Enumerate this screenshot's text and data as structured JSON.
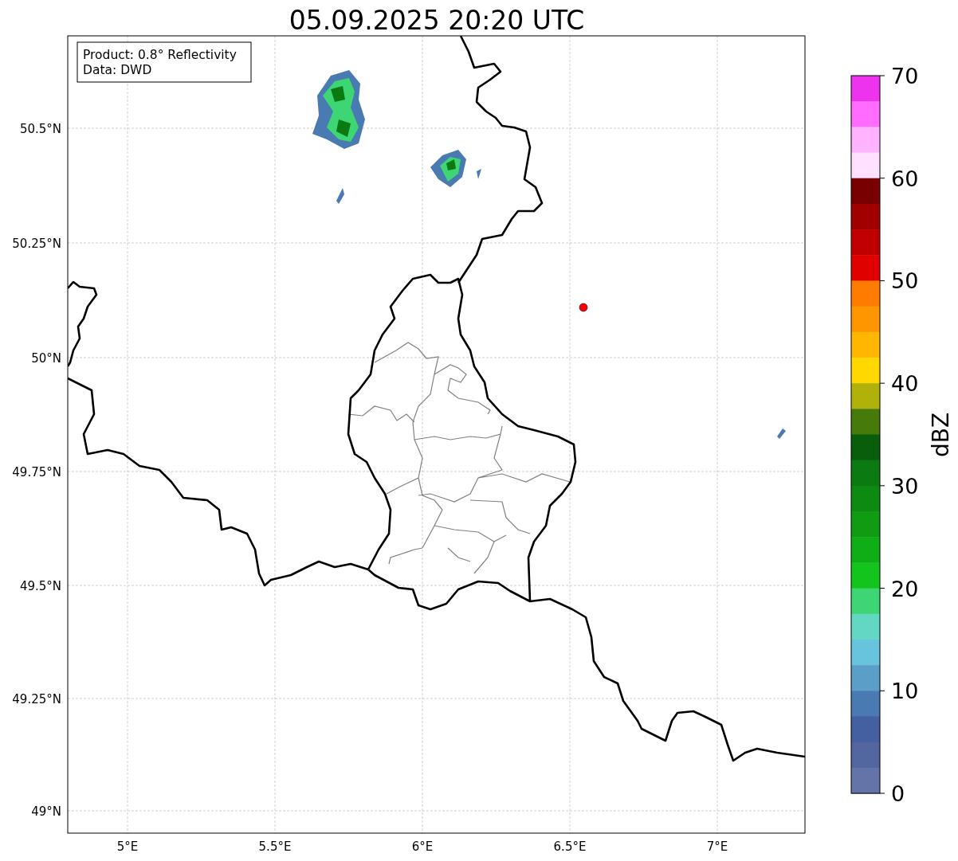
{
  "title": "05.09.2025 20:20 UTC",
  "map": {
    "info_box": [
      "Product: 0.8° Reflectivity",
      "Data: DWD"
    ],
    "lat_labels": [
      "50.5°N",
      "50.25°N",
      "50°N",
      "49.75°N",
      "49.5°N",
      "49.25°N",
      "49°N"
    ],
    "lon_labels": [
      "5°E",
      "5.5°E",
      "6°E",
      "6.5°E",
      "7°E"
    ]
  },
  "colorbar": {
    "label": "dBZ",
    "ticks": [
      "70",
      "60",
      "50",
      "40",
      "30",
      "20",
      "10",
      "0"
    ],
    "bands": [
      {
        "color": "#ee33ee"
      },
      {
        "color": "#ff6cff"
      },
      {
        "color": "#ffb3ff"
      },
      {
        "color": "#ffe0ff"
      },
      {
        "color": "#780000"
      },
      {
        "color": "#a00000"
      },
      {
        "color": "#c00000"
      },
      {
        "color": "#e00000"
      },
      {
        "color": "#ff7c00"
      },
      {
        "color": "#ff9600"
      },
      {
        "color": "#ffb600"
      },
      {
        "color": "#ffd800"
      },
      {
        "color": "#b0b20a"
      },
      {
        "color": "#467a0a"
      },
      {
        "color": "#085e0b"
      },
      {
        "color": "#0b7a10"
      },
      {
        "color": "#0c8a11"
      },
      {
        "color": "#0f9c13"
      },
      {
        "color": "#10ae16"
      },
      {
        "color": "#12c41c"
      },
      {
        "color": "#3ed674"
      },
      {
        "color": "#62d8c4"
      },
      {
        "color": "#68c3dc"
      },
      {
        "color": "#5b9fc8"
      },
      {
        "color": "#4a7ab2"
      },
      {
        "color": "#4560a0"
      },
      {
        "color": "#53669f"
      },
      {
        "color": "#6574a8"
      }
    ]
  }
}
